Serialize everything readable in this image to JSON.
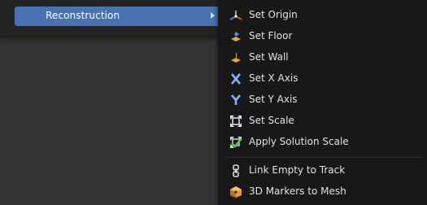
{
  "parent_menu": {
    "item_label": "Reconstruction",
    "highlight_color": "#4772b3"
  },
  "submenu": {
    "items": [
      {
        "label": "Set Origin",
        "icon": "origin-axes-icon"
      },
      {
        "label": "Set Floor",
        "icon": "floor-plane-icon"
      },
      {
        "label": "Set Wall",
        "icon": "wall-plane-icon"
      },
      {
        "label": "Set X Axis",
        "icon": "x-axis-icon"
      },
      {
        "label": "Set Y Axis",
        "icon": "y-axis-icon"
      },
      {
        "label": "Set Scale",
        "icon": "scale-icon"
      },
      {
        "label": "Apply Solution Scale",
        "icon": "apply-scale-icon"
      },
      {
        "label": "Link Empty to Track",
        "icon": "link-chain-icon"
      },
      {
        "label": "3D Markers to Mesh",
        "icon": "markers-mesh-icon"
      }
    ]
  }
}
